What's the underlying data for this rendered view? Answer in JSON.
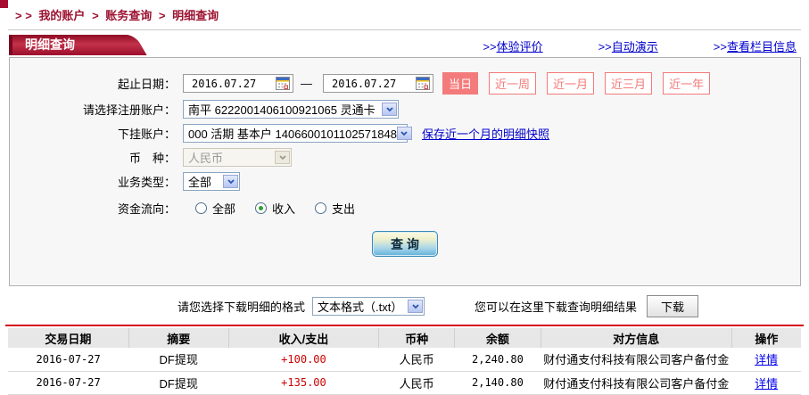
{
  "colors": {
    "brand_red": "#9c1230",
    "accent_salmon": "#f47b7b",
    "line_red": "#d40812",
    "amount_red": "#cc0000",
    "link_blue": "#0000cc"
  },
  "breadcrumb": {
    "prefix": "> >",
    "sep": ">",
    "items": [
      "我的账户",
      "账务查询",
      "明细查询"
    ]
  },
  "header": {
    "tab_label": "明细查询",
    "links": [
      {
        "prefix": ">>",
        "label": "体验评价"
      },
      {
        "prefix": ">>",
        "label": "自动演示"
      },
      {
        "prefix": ">>",
        "label": "查看栏目信息"
      }
    ]
  },
  "form": {
    "date_row": {
      "label": "起止日期：",
      "start_value": "2016.07.27",
      "dash": "—",
      "end_value": "2016.07.27",
      "quick_buttons": [
        {
          "label": "当日",
          "active": true
        },
        {
          "label": "近一周",
          "active": false
        },
        {
          "label": "近一月",
          "active": false
        },
        {
          "label": "近三月",
          "active": false
        },
        {
          "label": "近一年",
          "active": false
        }
      ]
    },
    "register_account": {
      "label": "请选择注册账户：",
      "value": "南平 6222001406100921065 灵通卡"
    },
    "sub_account": {
      "label": "下挂账户：",
      "value": "000 活期 基本户 1406600101102571848",
      "snapshot_link": "保存近一个月的明细快照"
    },
    "currency": {
      "label": "币　种：",
      "value": "人民币",
      "disabled": true
    },
    "biz_type": {
      "label": "业务类型：",
      "value": "全部"
    },
    "flow": {
      "label": "资金流向：",
      "options": [
        {
          "label": "全部",
          "checked": false
        },
        {
          "label": "收入",
          "checked": true
        },
        {
          "label": "支出",
          "checked": false
        }
      ]
    },
    "query_button": "查 询"
  },
  "download": {
    "format_label": "请您选择下载明细的格式",
    "format_value": "文本格式（.txt）",
    "hint": "您可以在这里下载查询明细结果",
    "button": "下载"
  },
  "table": {
    "headers": [
      "交易日期",
      "摘要",
      "收入/支出",
      "币种",
      "余额",
      "对方信息",
      "操作"
    ],
    "rows": [
      [
        "2016-07-27",
        "DF提现",
        "+100.00",
        "人民币",
        "2,240.80",
        "财付通支付科技有限公司客户备付金",
        "详情"
      ],
      [
        "2016-07-27",
        "DF提现",
        "+135.00",
        "人民币",
        "2,140.80",
        "财付通支付科技有限公司客户备付金",
        "详情"
      ]
    ]
  }
}
